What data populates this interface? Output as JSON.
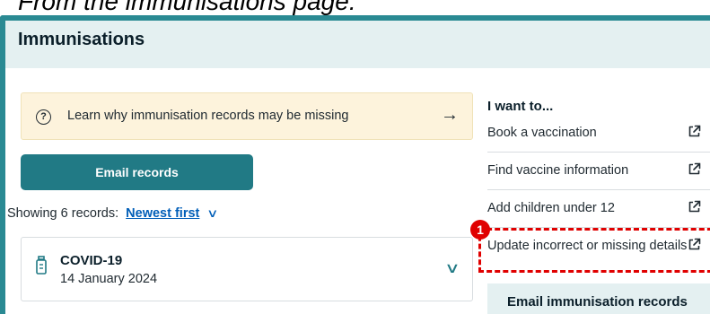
{
  "caption": "From the immunisations page:",
  "banner": {
    "title": "Immunisations"
  },
  "callout": {
    "text": "Learn why immunisation records may be missing",
    "icon": "question-circle-icon"
  },
  "email_button": {
    "label": "Email records"
  },
  "sort": {
    "prefix": "Showing 6 records:",
    "link": "Newest first"
  },
  "records": [
    {
      "name": "COVID-19",
      "date": "14 January 2024",
      "icon": "vial-icon"
    }
  ],
  "sidebar": {
    "title": "I want to...",
    "items": [
      {
        "label": "Book a vaccination"
      },
      {
        "label": "Find vaccine information"
      },
      {
        "label": "Add children under 12"
      },
      {
        "label": "Update incorrect or missing details"
      }
    ],
    "panel_title": "Email immunisation records"
  },
  "annotation": {
    "badge": "1",
    "color": "#e00000"
  },
  "colors": {
    "accent": "#217a85",
    "banner_bg": "#e4f0f1",
    "callout_bg": "#fdf3dc",
    "link": "#005eb8"
  }
}
